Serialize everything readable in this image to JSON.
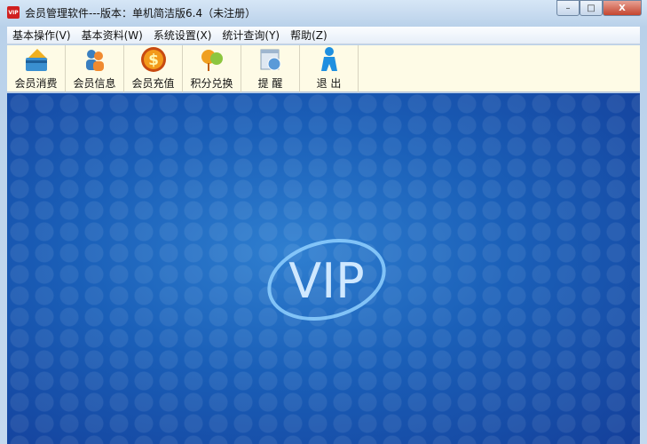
{
  "window": {
    "title": "会员管理软件---版本：单机简洁版6.4（未注册）",
    "app_icon_text": "VIP",
    "minimize": "–",
    "maximize": "□",
    "close": "X"
  },
  "menu": [
    "基本操作(V)",
    "基本资料(W)",
    "系统设置(X)",
    "统计查询(Y)",
    "帮助(Z)"
  ],
  "toolbar": [
    {
      "label": "会员消费",
      "icon": "credit-card-icon"
    },
    {
      "label": "会员信息",
      "icon": "users-icon"
    },
    {
      "label": "会员充值",
      "icon": "dollar-coin-icon"
    },
    {
      "label": "积分兑换",
      "icon": "exchange-icon"
    },
    {
      "label": "提 醒",
      "icon": "reminder-clock-icon"
    },
    {
      "label": "退 出",
      "icon": "exit-person-icon"
    }
  ],
  "main": {
    "logo_text": "VIP"
  }
}
